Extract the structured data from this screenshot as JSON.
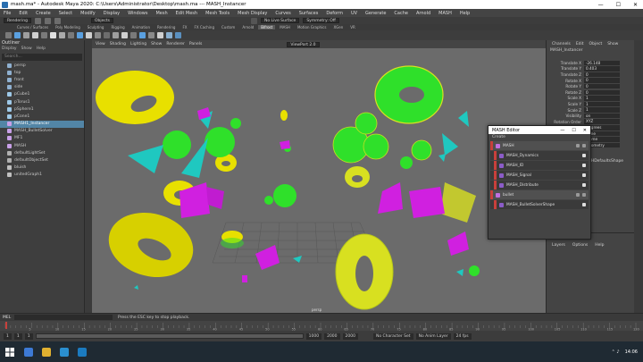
{
  "window": {
    "title": "mash.ma* - Autodesk Maya 2020: C:\\Users\\Administrator\\Desktop\\mash.ma  ---  MASH_Instancer",
    "controls": [
      "—",
      "☐",
      "✕"
    ]
  },
  "menus": [
    "File",
    "Edit",
    "Create",
    "Select",
    "Modify",
    "Display",
    "Windows",
    "Mesh",
    "Edit Mesh",
    "Mesh Tools",
    "Mesh Display",
    "Curves",
    "Surfaces",
    "Deform",
    "UV",
    "Generate",
    "Cache",
    "Arnold",
    "MASH",
    "Help"
  ],
  "status": {
    "mode": "Rendering",
    "objects": "Objects",
    "live_surface": "No Live Surface",
    "symmetry": "Symmetry: Off"
  },
  "shelf_tabs": [
    "Curves / Surfaces",
    "Poly Modeling",
    "Sculpting",
    "Rigging",
    "Animation",
    "Rendering",
    "FX",
    "FX Caching",
    "Custom",
    "Arnold",
    "Bifrost",
    "MASH",
    "Motion Graphics",
    "XGen",
    "VR"
  ],
  "active_shelf": "Bifrost",
  "outliner": {
    "title": "Outliner",
    "menu": [
      "Display",
      "Show",
      "Help"
    ],
    "search": "Search...",
    "items": [
      "persp",
      "top",
      "front",
      "side",
      "pCube1",
      "pTorus1",
      "pSphere1",
      "pCone1",
      "MASH1_Instancer",
      "MASH_BulletSolver",
      "MF1",
      "MASH",
      "defaultLightSet",
      "defaultObjectSet",
      "bluish",
      "unitedGraph1"
    ],
    "selected_index": 8
  },
  "viewport": {
    "menu": [
      "View",
      "Shading",
      "Lighting",
      "Show",
      "Renderer",
      "Panels"
    ],
    "camera_label": "persp",
    "renderer": "ViewPort 2.0"
  },
  "channel_box": {
    "tabs": [
      "Channels",
      "Edit",
      "Object",
      "Show"
    ],
    "node": "MASH_Instancer",
    "rows": [
      [
        "Translate X",
        "-26.148"
      ],
      [
        "Translate Y",
        "0.403"
      ],
      [
        "Translate Z",
        "0"
      ],
      [
        "Rotate X",
        "0"
      ],
      [
        "Rotate Y",
        "0"
      ],
      [
        "Rotate Z",
        "0"
      ],
      [
        "Scale X",
        "1"
      ],
      [
        "Scale Y",
        "1"
      ],
      [
        "Scale Z",
        "1"
      ],
      [
        "Visibility",
        "on"
      ],
      [
        "Rotation Order",
        "XYZ"
      ],
      [
        "Rotation Units",
        "Degrees"
      ],
      [
        "Inherits Transform",
        "None"
      ],
      [
        "Draw Detail",
        "Frame"
      ],
      [
        "Instancing",
        "Geometry"
      ]
    ],
    "section_header": "SHAPES",
    "shape_node": "MASHDefaultsShape"
  },
  "layer_panel": {
    "tabs": [
      "Display",
      "Anim"
    ],
    "menu": [
      "Layers",
      "Options",
      "Help"
    ]
  },
  "mash_editor": {
    "title": "MASH Editor",
    "controls": [
      "—",
      "☐",
      "✕"
    ],
    "menu": "Create",
    "networks": [
      {
        "name": "MASH",
        "nodes": [
          "MASH_Dynamics",
          "MASH_ID",
          "MASH_Signal",
          "MASH_Distribute"
        ]
      },
      {
        "name": "bullet",
        "nodes": [
          "MASH_BulletSolverShape"
        ]
      }
    ]
  },
  "command_line": {
    "label": "MEL",
    "help": "Press the ESC key to stop playback."
  },
  "time": {
    "ticks": [
      "5",
      "10",
      "15",
      "20",
      "25",
      "30",
      "35",
      "40",
      "45",
      "50",
      "55",
      "60",
      "65",
      "70",
      "75",
      "80",
      "85",
      "90",
      "95",
      "100",
      "105",
      "110",
      "115",
      "120"
    ],
    "current_frame": "1",
    "range_start": "1",
    "range_end": "1000",
    "anim_start": "1",
    "anim_end": "2000",
    "total": "2000",
    "character_set": "No Character Set",
    "anim_layer": "No Anim Layer",
    "fps": "24 fps"
  },
  "taskbar": {
    "clock": "14:06"
  },
  "colors": {
    "yellow": "#e8e000",
    "green": "#2fe02a",
    "magenta": "#d020e0",
    "cyan": "#1fc8c0",
    "selection": "#5285a6"
  }
}
